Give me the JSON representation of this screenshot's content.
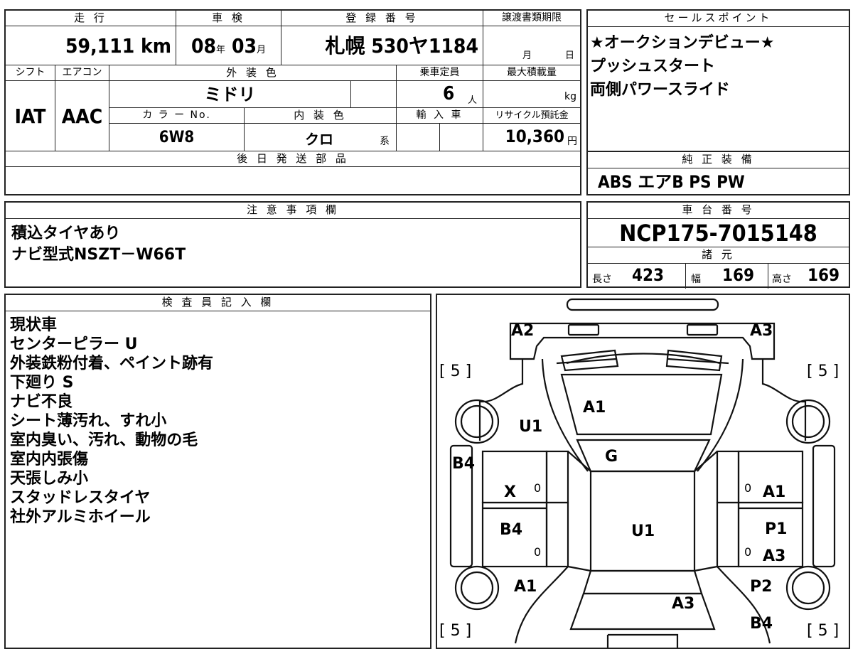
{
  "header": {
    "mileage_label": "走 行",
    "mileage_value": "59,111 km",
    "inspection_label": "車 検",
    "inspection_year": "08",
    "inspection_year_unit": "年",
    "inspection_month": "03",
    "inspection_month_unit": "月",
    "reg_label": "登 録 番 号",
    "reg_value": "札幌 530ヤ1184",
    "transfer_label": "譲渡書類期限",
    "transfer_month_unit": "月",
    "transfer_day_unit": "日",
    "shift_label": "シフト",
    "aircon_label": "エアコン",
    "exterior_label": "外 装 色",
    "capacity_label": "乗車定員",
    "maxload_label": "最大積載量",
    "shift_value": "IAT",
    "aircon_value": "AAC",
    "exterior_value": "ミドリ",
    "capacity_value": "6",
    "capacity_unit": "人",
    "maxload_unit": "kg",
    "colorno_label": "カ ラ ー No.",
    "interior_label": "内 装 色",
    "import_label": "輸 入 車",
    "recycle_label": "リサイクル預託金",
    "colorno_value": "6W8",
    "interior_value": "クロ",
    "interior_unit": "系",
    "recycle_value": "10,360",
    "recycle_unit": "円",
    "later_parts_label": "後 日 発 送 部 品"
  },
  "sales": {
    "label": "セールスポイント",
    "lines": [
      "★オークションデビュー★",
      "プッシュスタート",
      "両側パワースライド"
    ]
  },
  "equipment": {
    "label": "純 正 装 備",
    "value": "ABS エアB PS PW"
  },
  "notes": {
    "label": "注 意 事 項 欄",
    "lines": [
      "積込タイヤあり",
      "ナビ型式NSZT－W66T"
    ]
  },
  "chassis": {
    "label": "車 台 番 号",
    "value": "NCP175-7015148",
    "spec_label": "諸 元",
    "length_label": "長さ",
    "length_value": "423",
    "width_label": "幅",
    "width_value": "169",
    "height_label": "高さ",
    "height_value": "169"
  },
  "inspector": {
    "label": "検 査 員 記 入 欄",
    "lines": [
      "現状車",
      "センターピラー U",
      "外装鉄粉付着、ペイント跡有",
      "下廻り S",
      "ナビ不良",
      "シート薄汚れ、すれ小",
      "室内臭い、汚れ、動物の毛",
      "室内内張傷",
      "天張しみ小",
      "スタッドレスタイヤ",
      "社外アルミホイール"
    ]
  },
  "diagram": {
    "tire_left_top": "[ 5 ]",
    "tire_right_top": "[ 5 ]",
    "tire_left_bottom": "[ 5 ]",
    "tire_right_bottom": "[ 5 ]",
    "a2": "A2",
    "a3_top": "A3",
    "a1_hood": "A1",
    "u1_left": "U1",
    "g": "G",
    "b4_left": "B4",
    "x": "X",
    "a1_right": "A1",
    "b4_mid": "B4",
    "u1_roof": "U1",
    "p1": "P1",
    "a3_right": "A3",
    "a1_rear_left": "A1",
    "p2": "P2",
    "a3_rear": "A3",
    "b4_right": "B4",
    "zero1": "0",
    "zero2": "0",
    "zero3": "0",
    "zero4": "0"
  }
}
